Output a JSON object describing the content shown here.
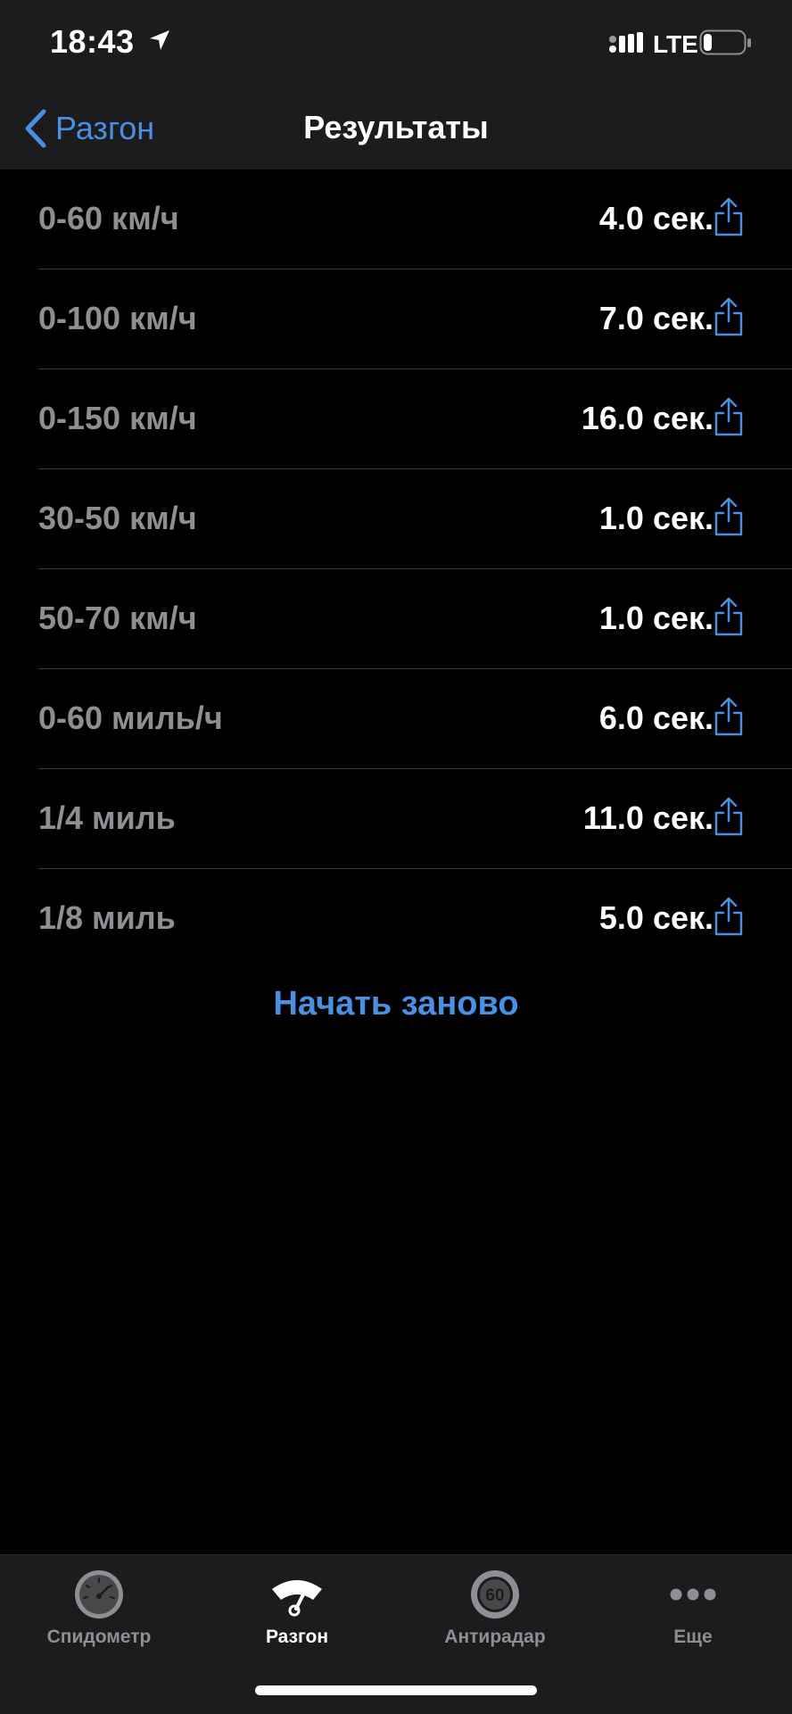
{
  "status_bar": {
    "time": "18:43",
    "network": "LTE",
    "battery_level": 0.15
  },
  "nav": {
    "back_label": "Разгон",
    "title": "Результаты"
  },
  "results": [
    {
      "label": "0-60 км/ч",
      "value": "4.0 сек."
    },
    {
      "label": "0-100 км/ч",
      "value": "7.0 сек."
    },
    {
      "label": "0-150 км/ч",
      "value": "16.0 сек."
    },
    {
      "label": "30-50 км/ч",
      "value": "1.0 сек."
    },
    {
      "label": "50-70 км/ч",
      "value": "1.0 сек."
    },
    {
      "label": "0-60 миль/ч",
      "value": "6.0 сек."
    },
    {
      "label": "1/4 миль",
      "value": "11.0 сек."
    },
    {
      "label": "1/8 миль",
      "value": "5.0 сек."
    }
  ],
  "restart_label": "Начать заново",
  "tabs": [
    {
      "label": "Спидометр",
      "icon": "speedometer-icon",
      "active": false
    },
    {
      "label": "Разгон",
      "icon": "acceleration-icon",
      "active": true
    },
    {
      "label": "Антирадар",
      "icon": "speed-limit-60-icon",
      "active": false
    },
    {
      "label": "Еще",
      "icon": "more-dots-icon",
      "active": false
    }
  ],
  "tab_speed_limit_text": "60",
  "colors": {
    "accent": "#4a90e2",
    "background": "#000000",
    "bar_background": "#1c1c1e",
    "secondary_text": "#8e8e93",
    "separator": "#3a3a3c"
  }
}
